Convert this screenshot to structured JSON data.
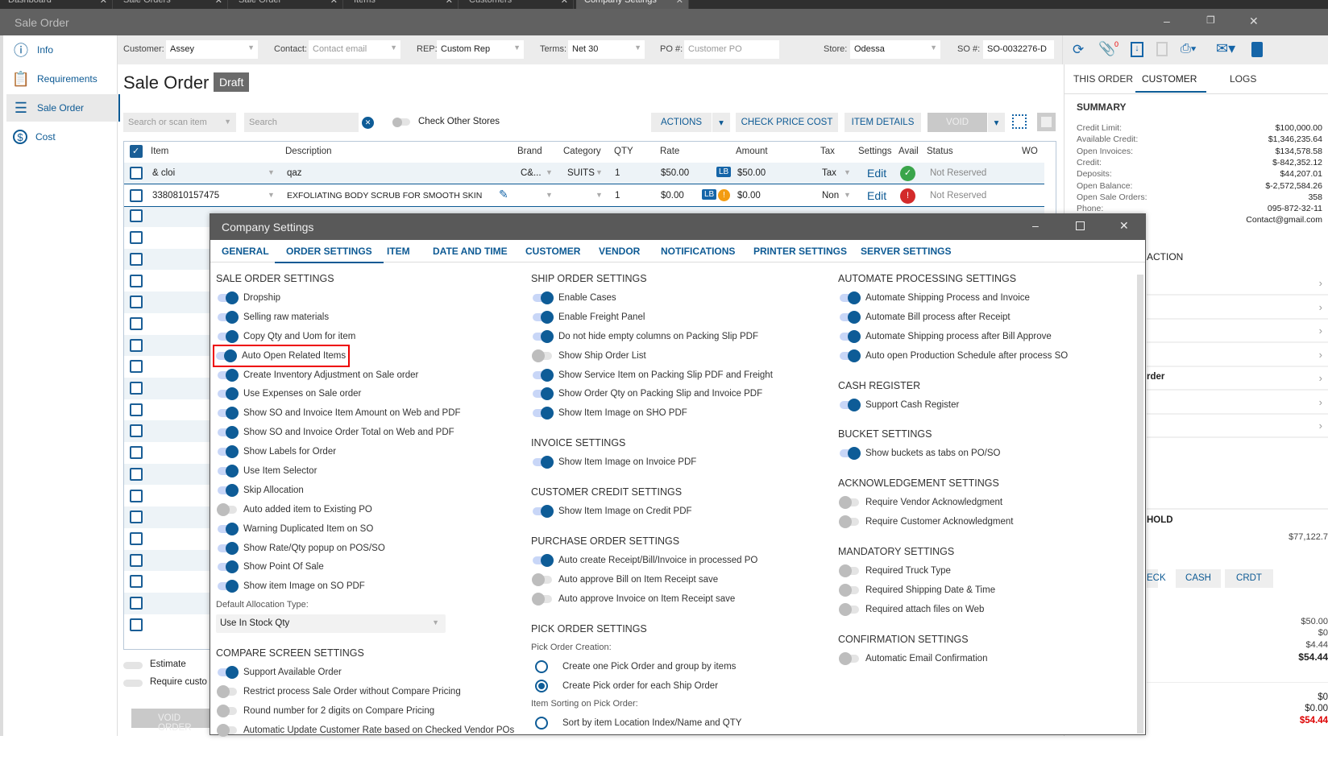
{
  "tabs": [
    "Dashboard",
    "Sale Orders",
    "Sale Order",
    "Items",
    "Customers",
    "Company Settings"
  ],
  "window": {
    "title": "Sale Order"
  },
  "sidebar": [
    {
      "label": "Info",
      "icon": "info-icon"
    },
    {
      "label": "Requirements",
      "icon": "clipboard-icon"
    },
    {
      "label": "Sale Order",
      "icon": "list-icon"
    },
    {
      "label": "Cost",
      "icon": "dollar-icon"
    }
  ],
  "fields": {
    "customer_label": "Customer:",
    "customer": "Assey",
    "contact_label": "Contact:",
    "contact_ph": "Contact email",
    "rep_label": "REP:",
    "rep": "Custom Rep",
    "terms_label": "Terms:",
    "terms": "Net 30",
    "po_label": "PO #:",
    "po_ph": "Customer PO",
    "store_label": "Store:",
    "store": "Odessa",
    "so_label": "SO #:",
    "so": "SO-0032276-D",
    "attach_count": "0"
  },
  "page": {
    "title": "Sale Order",
    "status": "Draft"
  },
  "toolbar": {
    "search_item_ph": "Search or scan item",
    "search_ph": "Search",
    "check_other": "Check Other Stores",
    "actions": "ACTIONS",
    "check_price": "CHECK PRICE COST",
    "item_details": "ITEM DETAILS",
    "void": "VOID"
  },
  "grid": {
    "headers": [
      "Item",
      "Description",
      "Brand",
      "Category",
      "QTY",
      "Rate",
      "Amount",
      "Tax",
      "Settings",
      "Avail",
      "Status",
      "WO"
    ],
    "rows": [
      {
        "item": "& cloi",
        "desc": "qaz",
        "brand": "C&...",
        "category": "SUITS",
        "qty": "1",
        "rate": "$50.00",
        "badge": "LB",
        "amount": "$50.00",
        "tax": "Tax",
        "settings": "Edit",
        "avail": "ok",
        "status": "Not Reserved"
      },
      {
        "item": "3380810157475",
        "desc": "EXFOLIATING BODY SCRUB FOR SMOOTH SKIN",
        "brand": "",
        "category": "",
        "qty": "1",
        "rate": "$0.00",
        "badge": "LB",
        "amount": "$0.00",
        "tax": "Non",
        "settings": "Edit",
        "avail": "error",
        "status": "Not Reserved"
      }
    ]
  },
  "bottom": {
    "estimate": "Estimate",
    "require": "Require custo",
    "void_order": "VOID ORDER"
  },
  "right": {
    "tabs": [
      "THIS ORDER",
      "CUSTOMER",
      "LOGS"
    ],
    "summary_title": "SUMMARY",
    "summary": [
      [
        "Credit Limit:",
        "$100,000.00"
      ],
      [
        "Available Credit:",
        "$1,346,235.64"
      ],
      [
        "Open Invoices:",
        "$134,578.58"
      ],
      [
        "Credit:",
        "$-842,352.12"
      ],
      [
        "Deposits:",
        "$44,207.01"
      ],
      [
        "Open Balance:",
        "$-2,572,584.26"
      ],
      [
        "Open Sale Orders:",
        "358"
      ],
      [
        "Phone:",
        "095-872-32-11"
      ],
      [
        "",
        "Contact@gmail.com"
      ]
    ],
    "action_title": "ACTION",
    "action_row_fragment": "rder",
    "hold_title": "HOLD",
    "hold_value": "$77,122.7",
    "pay_buttons": [
      "ECK",
      "CASH",
      "CRDT"
    ],
    "totals": [
      "$50.00",
      "$0",
      "$4.44",
      "$54.44"
    ],
    "bottom_totals": [
      "$0",
      "$0.00",
      "$54.44"
    ]
  },
  "modal": {
    "title": "Company Settings",
    "tabs": [
      "GENERAL",
      "ORDER SETTINGS",
      "ITEM",
      "DATE AND TIME",
      "CUSTOMER",
      "VENDOR",
      "NOTIFICATIONS",
      "PRINTER SETTINGS",
      "SERVER SETTINGS"
    ],
    "active_tab": 1,
    "columns": [
      [
        {
          "type": "sec",
          "text": "SALE ORDER SETTINGS"
        },
        {
          "type": "tg",
          "text": "Dropship",
          "on": true
        },
        {
          "type": "tg",
          "text": "Selling raw materials",
          "on": true
        },
        {
          "type": "tg",
          "text": "Copy Qty and Uom for item",
          "on": true
        },
        {
          "type": "tg",
          "text": "Auto Open Related Items",
          "on": true,
          "highlight": true
        },
        {
          "type": "tg",
          "text": "Create Inventory Adjustment on Sale order",
          "on": true
        },
        {
          "type": "tg",
          "text": "Use Expenses on Sale order",
          "on": true
        },
        {
          "type": "tg",
          "text": "Show SO and Invoice Item Amount on Web and PDF",
          "on": true
        },
        {
          "type": "tg",
          "text": "Show SO and Invoice Order Total on Web and PDF",
          "on": true
        },
        {
          "type": "tg",
          "text": "Show Labels for Order",
          "on": true
        },
        {
          "type": "tg",
          "text": "Use Item Selector",
          "on": true
        },
        {
          "type": "tg",
          "text": "Skip Allocation",
          "on": true
        },
        {
          "type": "tg",
          "text": "Auto added item to Existing PO",
          "on": false
        },
        {
          "type": "tg",
          "text": "Warning Duplicated Item on SO",
          "on": true
        },
        {
          "type": "tg",
          "text": "Show Rate/Qty popup on POS/SO",
          "on": true
        },
        {
          "type": "tg",
          "text": "Show Point Of Sale",
          "on": true
        },
        {
          "type": "tg",
          "text": "Show item Image on SO PDF",
          "on": true
        },
        {
          "type": "lbl",
          "text": "Default Allocation Type:"
        },
        {
          "type": "select",
          "text": "Use In Stock Qty"
        },
        {
          "type": "sec",
          "text": "COMPARE SCREEN SETTINGS"
        },
        {
          "type": "tg",
          "text": "Support Available Order",
          "on": true
        },
        {
          "type": "tg",
          "text": "Restrict process Sale Order without Compare Pricing",
          "on": false
        },
        {
          "type": "tg",
          "text": "Round number for 2 digits on Compare Pricing",
          "on": false
        },
        {
          "type": "tg",
          "text": "Automatic Update Customer Rate based on Checked Vendor POs",
          "on": false
        }
      ],
      [
        {
          "type": "sec",
          "text": "SHIP ORDER SETTINGS"
        },
        {
          "type": "tg",
          "text": "Enable Cases",
          "on": true
        },
        {
          "type": "tg",
          "text": "Enable Freight Panel",
          "on": true
        },
        {
          "type": "tg",
          "text": "Do not hide empty columns on Packing Slip PDF",
          "on": true
        },
        {
          "type": "tg",
          "text": "Show Ship Order List",
          "on": false
        },
        {
          "type": "tg",
          "text": "Show Service Item on Packing Slip PDF and Freight",
          "on": true
        },
        {
          "type": "tg",
          "text": "Show Order Qty on Packing Slip and Invoice PDF",
          "on": true
        },
        {
          "type": "tg",
          "text": "Show Item Image on SHO PDF",
          "on": true
        },
        {
          "type": "sec",
          "text": "INVOICE SETTINGS"
        },
        {
          "type": "tg",
          "text": "Show Item Image on Invoice PDF",
          "on": true
        },
        {
          "type": "sec",
          "text": "CUSTOMER CREDIT SETTINGS"
        },
        {
          "type": "tg",
          "text": "Show Item Image on Credit PDF",
          "on": true
        },
        {
          "type": "sec",
          "text": "PURCHASE ORDER SETTINGS"
        },
        {
          "type": "tg",
          "text": "Auto create Receipt/Bill/Invoice in processed PO",
          "on": true
        },
        {
          "type": "tg",
          "text": "Auto approve Bill on Item Receipt save",
          "on": false
        },
        {
          "type": "tg",
          "text": "Auto approve Invoice on Item Receipt save",
          "on": false
        },
        {
          "type": "sec",
          "text": "PICK ORDER SETTINGS"
        },
        {
          "type": "lbl",
          "text": "Pick Order Creation:"
        },
        {
          "type": "radio",
          "text": "Create one Pick Order and group by items",
          "on": false
        },
        {
          "type": "radio",
          "text": "Create Pick order for each Ship Order",
          "on": true
        },
        {
          "type": "lbl",
          "text": "Item Sorting on Pick Order:"
        },
        {
          "type": "radio",
          "text": "Sort by item Location Index/Name and QTY",
          "on": false
        }
      ],
      [
        {
          "type": "sec",
          "text": "AUTOMATE PROCESSING SETTINGS"
        },
        {
          "type": "tg",
          "text": "Automate Shipping Process and Invoice",
          "on": true
        },
        {
          "type": "tg",
          "text": "Automate Bill process after Receipt",
          "on": true
        },
        {
          "type": "tg",
          "text": "Automate Shipping process after Bill Approve",
          "on": true
        },
        {
          "type": "tg",
          "text": "Auto open Production Schedule after process SO",
          "on": true
        },
        {
          "type": "sec",
          "text": "CASH REGISTER"
        },
        {
          "type": "tg",
          "text": "Support Cash Register",
          "on": true
        },
        {
          "type": "sec",
          "text": "BUCKET SETTINGS"
        },
        {
          "type": "tg",
          "text": "Show buckets as tabs on PO/SO",
          "on": true
        },
        {
          "type": "sec",
          "text": "ACKNOWLEDGEMENT SETTINGS"
        },
        {
          "type": "tg",
          "text": "Require Vendor Acknowledgment",
          "on": false
        },
        {
          "type": "tg",
          "text": "Require Customer Acknowledgment",
          "on": false
        },
        {
          "type": "sec",
          "text": "MANDATORY SETTINGS"
        },
        {
          "type": "tg",
          "text": "Required Truck Type",
          "on": false
        },
        {
          "type": "tg",
          "text": "Required Shipping Date & Time",
          "on": false
        },
        {
          "type": "tg",
          "text": "Required attach files on Web",
          "on": false
        },
        {
          "type": "sec",
          "text": "CONFIRMATION SETTINGS"
        },
        {
          "type": "tg",
          "text": "Automatic Email Confirmation",
          "on": false
        }
      ]
    ]
  },
  "colors": {
    "accent": "#0e5c97",
    "highlight": "#ee0000",
    "ok": "#3aa54a",
    "error": "#d32a2a",
    "warn": "#f39c12"
  }
}
